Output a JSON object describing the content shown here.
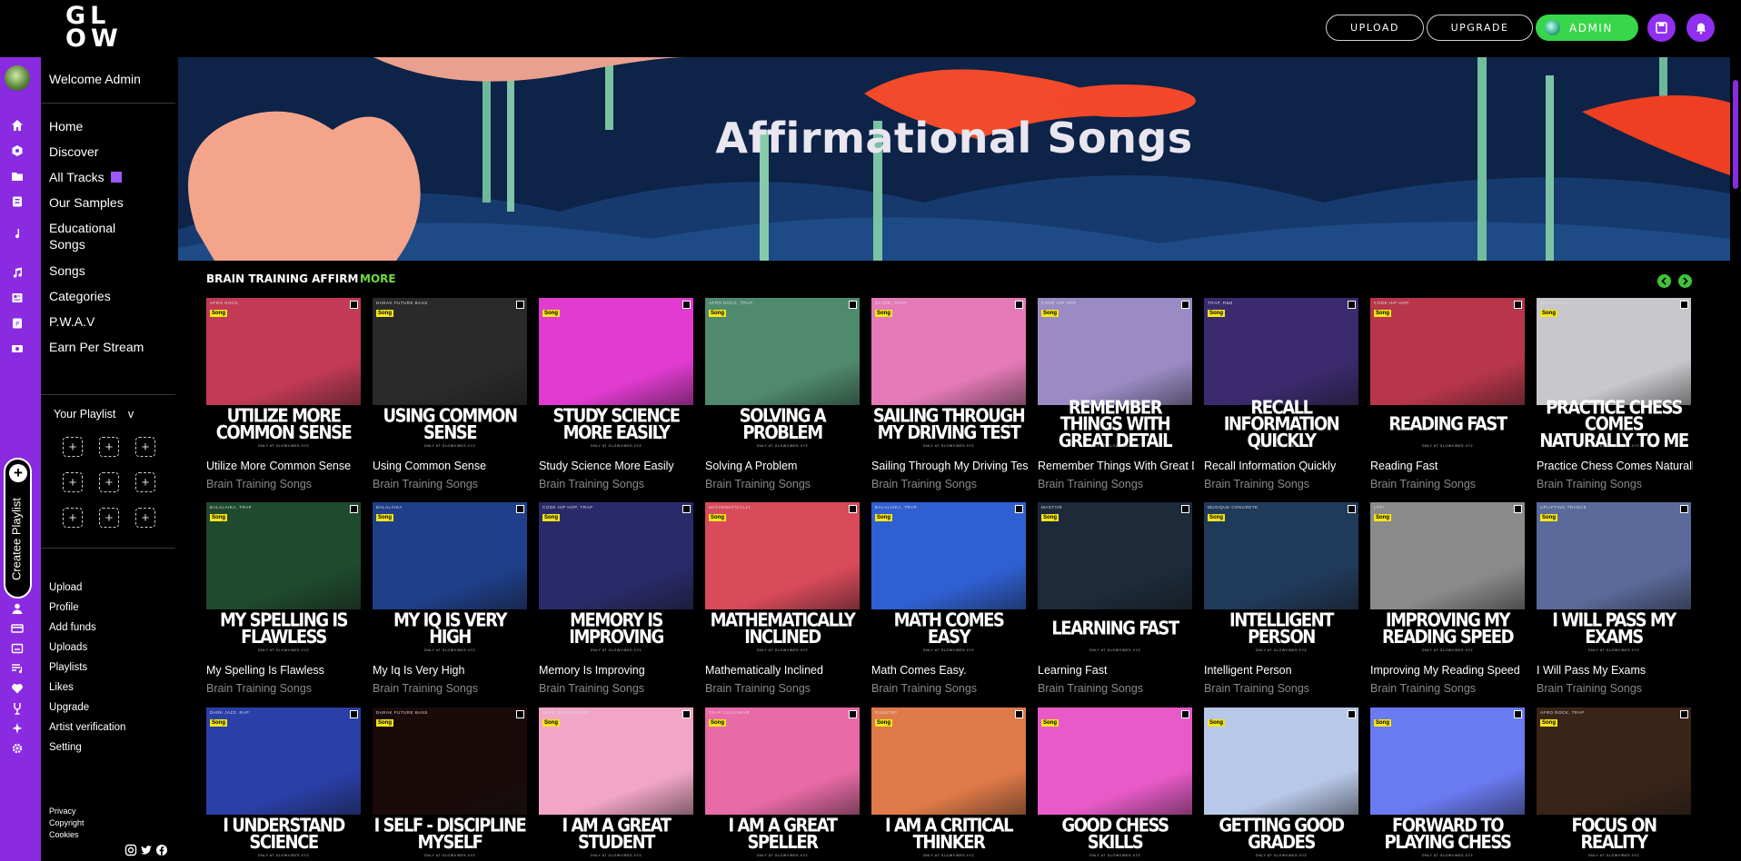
{
  "header": {
    "logo_line1": "GL",
    "logo_line2": "OW",
    "upload_label": "UPLOAD",
    "upgrade_label": "UPGRADE",
    "admin_label": "ADMIN",
    "save_icon": "save-icon",
    "bell_icon": "bell-icon"
  },
  "colors": {
    "accent": "#8a2be2",
    "green": "#38d64a",
    "more": "#6fdc3a"
  },
  "sidebar": {
    "welcome": "Welcome Admin",
    "nav": [
      "Home",
      "Discover",
      "All Tracks",
      "Our Samples",
      "Educational Songs",
      "Songs",
      "Categories",
      "P.W.A.V",
      "Earn Per Stream"
    ],
    "your_playlist": "Your Playlist",
    "your_playlist_chevron": "v",
    "create_playlist": "Createe Playlist",
    "sub": [
      "Upload",
      "Profile",
      "Add funds",
      "Uploads",
      "Playlists",
      "Likes",
      "Upgrade",
      "Artist verification",
      "Setting"
    ],
    "footer": [
      "Privacy",
      "Copyright",
      "Cookies"
    ]
  },
  "banner": {
    "title": "Affirmational Songs"
  },
  "section": {
    "title": "BRAIN TRAINING AFFIRM",
    "more": "MORE"
  },
  "common": {
    "song_tag": "Song",
    "stamp": "ONLY AT GLOWVIBES.XYZ"
  },
  "tracks": [
    {
      "cover": "UTILIZE MORE COMMON SENSE",
      "title": "Utilize More Common Sense",
      "artist": "Brain Training Songs",
      "genre": "AFRO ROCK",
      "bg": "#c23a55"
    },
    {
      "cover": "USING COMMON SENSE",
      "title": "Using Common Sense",
      "artist": "Brain Training Songs",
      "genre": "DARAK FUTURE BASS",
      "bg": "#2a2a2a"
    },
    {
      "cover": "STUDY SCIENCE MORE EASILY",
      "title": "Study Science More Easily",
      "artist": "Brain Training Songs",
      "genre": "",
      "bg": "#e23bd1"
    },
    {
      "cover": "SOLVING A PROBLEM",
      "title": "Solving A Problem",
      "artist": "Brain Training Songs",
      "genre": "AFRO ROCK, TRAP",
      "bg": "#4f8a6e"
    },
    {
      "cover": "SAILING THROUGH MY DRIVING TEST",
      "title": "Sailing Through My Driving Test",
      "artist": "Brain Training Songs",
      "genre": "GLYDE, TRAP",
      "bg": "#e57ab8"
    },
    {
      "cover": "REMEMBER THINGS WITH GREAT DETAIL",
      "title": "Remember Things With Great Detail",
      "artist": "Brain Training Songs",
      "genre": "CODE HIP HOP",
      "bg": "#9a8bc4"
    },
    {
      "cover": "RECALL INFORMATION QUICKLY",
      "title": "Recall Information Quickly",
      "artist": "Brain Training Songs",
      "genre": "TRAP, R&B",
      "bg": "#3b2a6e"
    },
    {
      "cover": "READING FAST",
      "title": "Reading Fast",
      "artist": "Brain Training Songs",
      "genre": "CODE HIP HOP",
      "bg": "#b8364a"
    },
    {
      "cover": "PRACTICE CHESS COMES NATURALLY TO ME",
      "title": "Practice Chess Comes Naturally To Me",
      "artist": "Brain Training Songs",
      "genre": "MOTOROCK",
      "bg": "#c8c8cc"
    },
    {
      "cover": "MY SPELLING IS FLAWLESS",
      "title": "My Spelling Is Flawless",
      "artist": "Brain Training Songs",
      "genre": "BALALAIKA, TRAP",
      "bg": "#1f4a2e"
    },
    {
      "cover": "MY IQ IS VERY HIGH",
      "title": "My Iq Is Very High",
      "artist": "Brain Training Songs",
      "genre": "BALALAIKA",
      "bg": "#1f3f8a"
    },
    {
      "cover": "MEMORY IS IMPROVING",
      "title": "Memory Is Improving",
      "artist": "Brain Training Songs",
      "genre": "CODE HIP HOP, TRAP",
      "bg": "#2a2a6a"
    },
    {
      "cover": "MATHEMATICALLY INCLINED",
      "title": "Mathematically Inclined",
      "artist": "Brain Training Songs",
      "genre": "MATHEMATICALLY",
      "bg": "#d94a5a"
    },
    {
      "cover": "MATH COMES EASY",
      "title": "Math Comes Easy.",
      "artist": "Brain Training Songs",
      "genre": "BALALAIKA, TRAP",
      "bg": "#2f5fd1"
    },
    {
      "cover": "LEARNING FAST",
      "title": "Learning Fast",
      "artist": "Brain Training Songs",
      "genre": "MASTIVE",
      "bg": "#1d2a3a"
    },
    {
      "cover": "INTELLIGENT PERSON",
      "title": "Intelligent Person",
      "artist": "Brain Training Songs",
      "genre": "MUSIQUE CONCRETE",
      "bg": "#203a5a"
    },
    {
      "cover": "IMPROVING MY READING SPEED",
      "title": "Improving My Reading Speed",
      "artist": "Brain Training Songs",
      "genre": "LOFI",
      "bg": "#8a8a8a"
    },
    {
      "cover": "I WILL PASS MY EXAMS",
      "title": "I Will Pass My Exams",
      "artist": "Brain Training Songs",
      "genre": "UPLIFTING TRANCE",
      "bg": "#5a6a9a"
    },
    {
      "cover": "I UNDERSTAND SCIENCE",
      "title": "",
      "artist": "",
      "genre": "DARK JAZZ, RAP",
      "bg": "#2a3fa8"
    },
    {
      "cover": "I SELF - DISCIPLINE MYSELF",
      "title": "",
      "artist": "",
      "genre": "DARAK FUTURE BASS",
      "bg": "#1a0a0a"
    },
    {
      "cover": "I AM A GREAT STUDENT",
      "title": "",
      "artist": "",
      "genre": "TRAP, BREAKCORE",
      "bg": "#f2a6c6"
    },
    {
      "cover": "I AM A GREAT SPELLER",
      "title": "",
      "artist": "",
      "genre": "TRAP CHILLWAVE",
      "bg": "#e86aa6"
    },
    {
      "cover": "I AM A CRITICAL THINKER",
      "title": "",
      "artist": "",
      "genre": "DUBSTEP",
      "bg": "#e07a48"
    },
    {
      "cover": "GOOD CHESS SKILLS",
      "title": "",
      "artist": "",
      "genre": "",
      "bg": "#e85ac8"
    },
    {
      "cover": "GETTING GOOD GRADES",
      "title": "",
      "artist": "",
      "genre": "",
      "bg": "#b8c8e8"
    },
    {
      "cover": "FORWARD TO PLAYING CHESS",
      "title": "",
      "artist": "",
      "genre": "",
      "bg": "#6a7af0"
    },
    {
      "cover": "FOCUS ON REALITY",
      "title": "",
      "artist": "",
      "genre": "AFRO ROCK, TRAP",
      "bg": "#3a2418"
    }
  ]
}
